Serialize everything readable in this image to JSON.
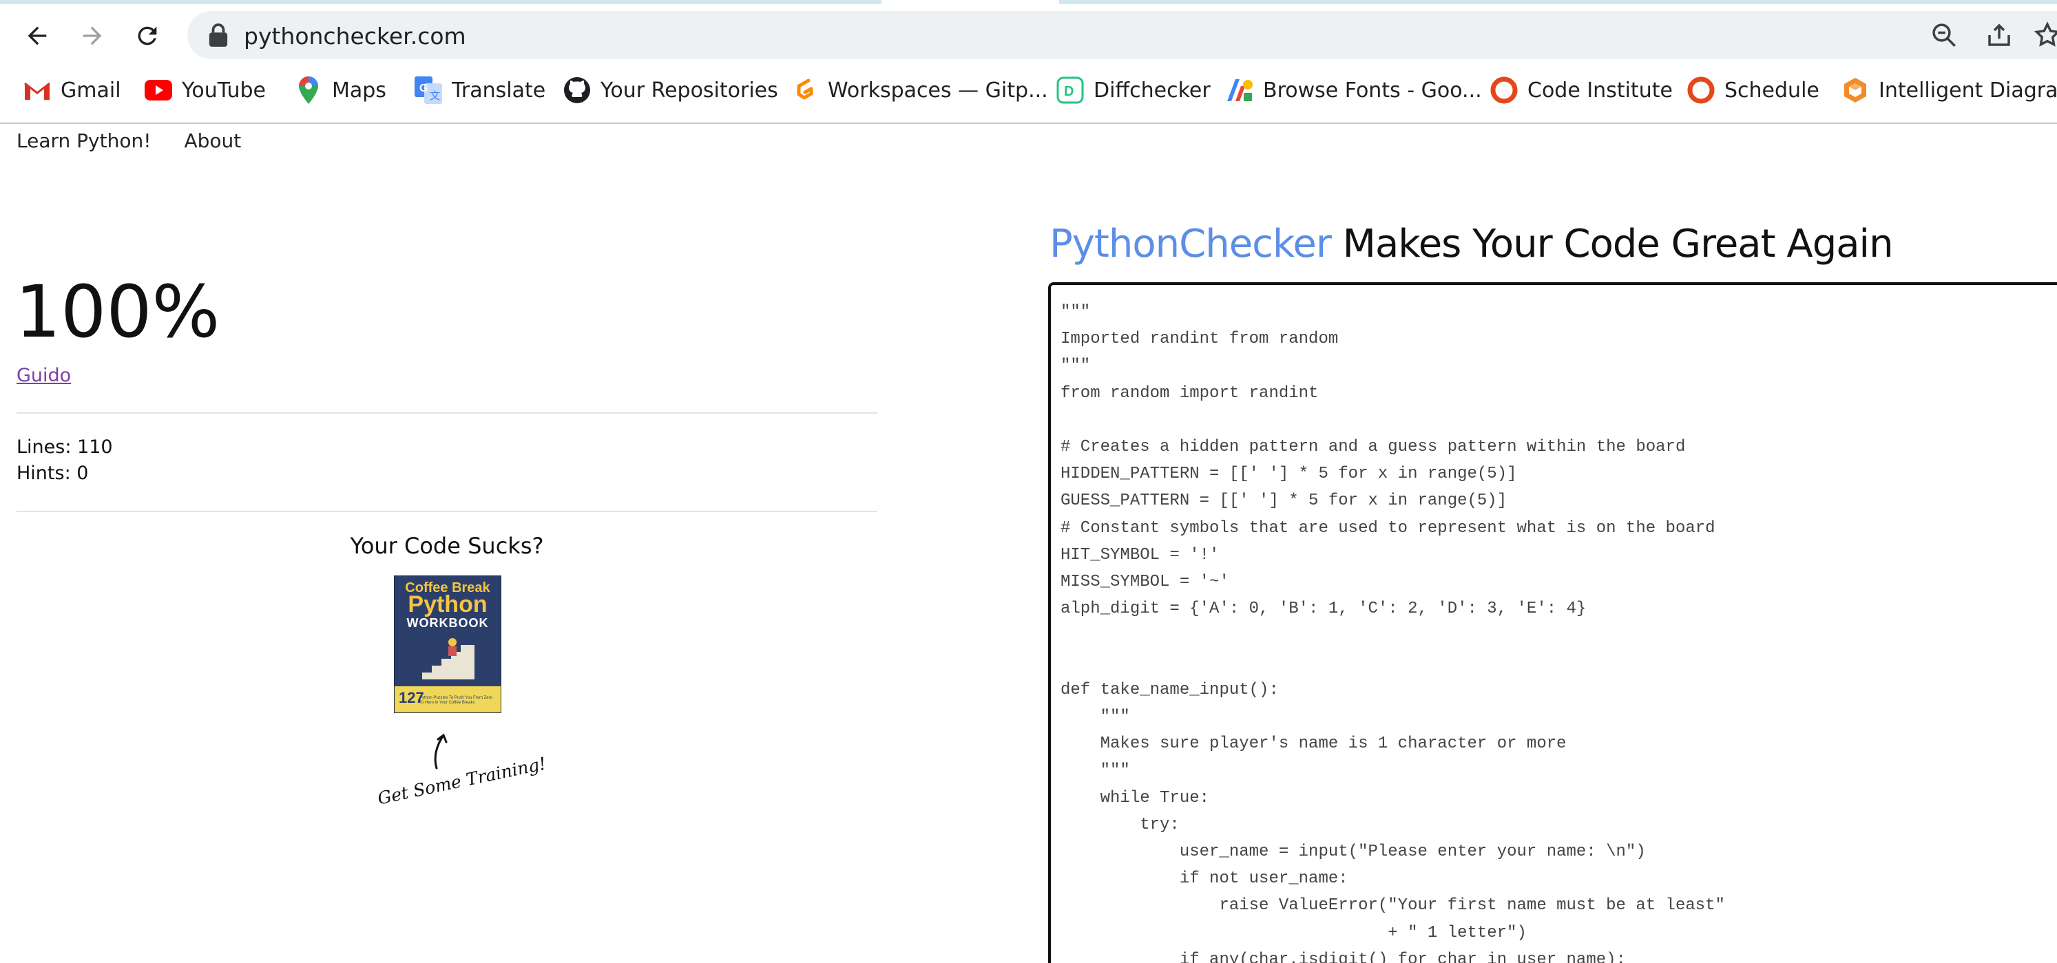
{
  "browser": {
    "url": "pythonchecker.com",
    "bookmarks": [
      {
        "label": "Gmail",
        "icon": "gmail-icon"
      },
      {
        "label": "YouTube",
        "icon": "youtube-icon"
      },
      {
        "label": "Maps",
        "icon": "maps-icon"
      },
      {
        "label": "Translate",
        "icon": "translate-icon"
      },
      {
        "label": "Your Repositories",
        "icon": "github-icon"
      },
      {
        "label": "Workspaces — Gitp...",
        "icon": "gitpod-icon"
      },
      {
        "label": "Diffchecker",
        "icon": "diffchecker-icon"
      },
      {
        "label": "Browse Fonts - Goo...",
        "icon": "google-fonts-icon"
      },
      {
        "label": "Code Institute",
        "icon": "code-institute-icon"
      },
      {
        "label": "Schedule",
        "icon": "schedule-icon"
      },
      {
        "label": "Intelligent Diagram",
        "icon": "diagram-icon"
      }
    ]
  },
  "nav": {
    "learn": "Learn Python!",
    "about": "About"
  },
  "result": {
    "score": "100%",
    "author_link": "Guido",
    "lines": "Lines: 110",
    "hints": "Hints: 0"
  },
  "promo": {
    "title": "Your Code Sucks?",
    "book_line1": "Coffee Break",
    "book_line2": "Python",
    "book_line3": "WORKBOOK",
    "book_number": "127",
    "book_subtitle": "Python Puzzles To Push You From Zero To Hero in Your Coffee Breaks",
    "caption": "Get Some Training!"
  },
  "headline": {
    "brand": "PythonChecker",
    "rest": " Makes Your Code Great Again"
  },
  "code": "\"\"\"\nImported randint from random\n\"\"\"\nfrom random import randint\n\n# Creates a hidden pattern and a guess pattern within the board\nHIDDEN_PATTERN = [[' '] * 5 for x in range(5)]\nGUESS_PATTERN = [[' '] * 5 for x in range(5)]\n# Constant symbols that are used to represent what is on the board\nHIT_SYMBOL = '!'\nMISS_SYMBOL = '~'\nalph_digit = {'A': 0, 'B': 1, 'C': 2, 'D': 3, 'E': 4}\n\n\ndef take_name_input():\n    \"\"\"\n    Makes sure player's name is 1 character or more\n    \"\"\"\n    while True:\n        try:\n            user_name = input(\"Please enter your name: \\n\")\n            if not user_name:\n                raise ValueError(\"Your first name must be at least\"\n                                 + \" 1 letter\")\n            if any(char.isdigit() for char in user_name):",
  "colors": {
    "brand": "#5b8ee6",
    "link_visited": "#7b3fa7",
    "book_cover": "#2c3f6b",
    "book_accent": "#f5c542"
  }
}
